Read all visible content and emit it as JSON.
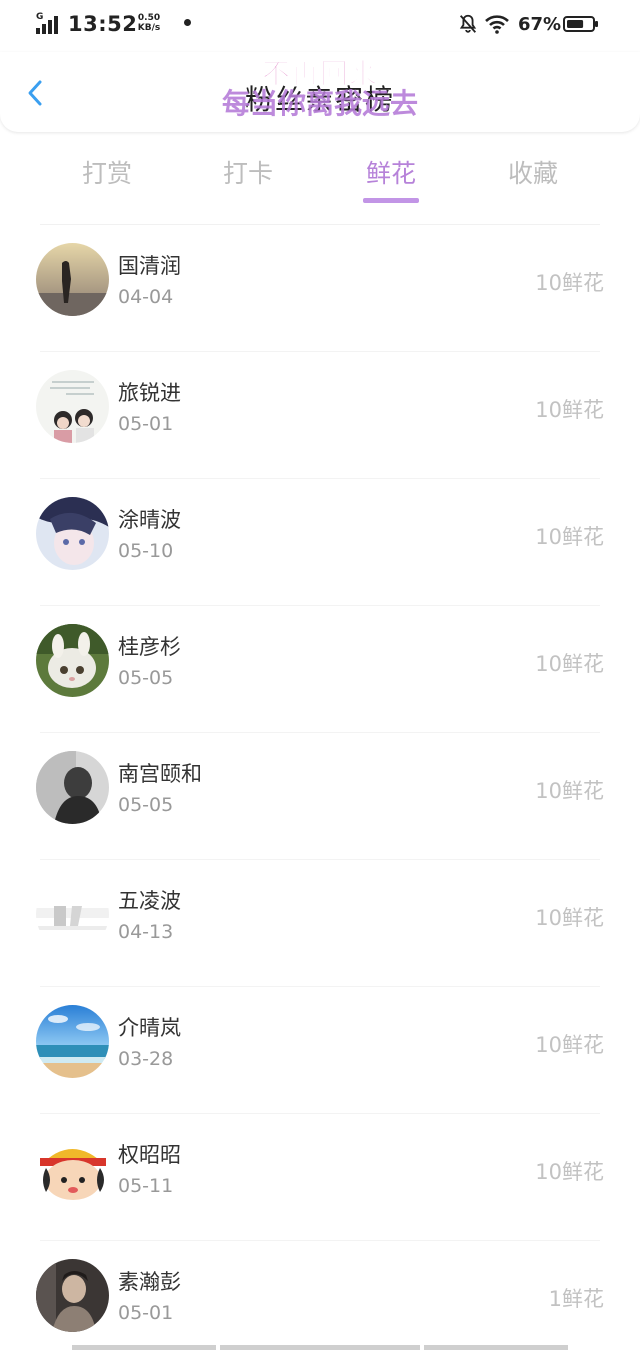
{
  "status_bar": {
    "network": "G",
    "time": "13:52",
    "speed_value": "0.50",
    "speed_unit": "KB/s",
    "battery_percent": "67%",
    "battery_level": 0.67
  },
  "header": {
    "title": "粉丝亲密榜",
    "watermark_top": "不再回来",
    "watermark_bottom": "每当你离我远去"
  },
  "tabs": [
    {
      "label": "打赏",
      "active": false
    },
    {
      "label": "打卡",
      "active": false
    },
    {
      "label": "鲜花",
      "active": true
    },
    {
      "label": "收藏",
      "active": false
    }
  ],
  "accent_color": "#b682d9",
  "list": [
    {
      "name": "国清润",
      "date": "04-04",
      "amount": "10鲜花",
      "avatar": "silhouette-photo"
    },
    {
      "name": "旅锐进",
      "date": "05-01",
      "amount": "10鲜花",
      "avatar": "two-girls-photo"
    },
    {
      "name": "涂晴波",
      "date": "05-10",
      "amount": "10鲜花",
      "avatar": "anime-portrait"
    },
    {
      "name": "桂彦杉",
      "date": "05-05",
      "amount": "10鲜花",
      "avatar": "cat-photo"
    },
    {
      "name": "南宫颐和",
      "date": "05-05",
      "amount": "10鲜花",
      "avatar": "bw-portrait"
    },
    {
      "name": "五凌波",
      "date": "04-13",
      "amount": "10鲜花",
      "avatar": "faded-sketch"
    },
    {
      "name": "介晴岚",
      "date": "03-28",
      "amount": "10鲜花",
      "avatar": "beach-photo"
    },
    {
      "name": "权昭昭",
      "date": "05-11",
      "amount": "10鲜花",
      "avatar": "cartoon-girl"
    },
    {
      "name": "素瀚彭",
      "date": "05-01",
      "amount": "1鲜花",
      "avatar": "dark-portrait"
    }
  ]
}
